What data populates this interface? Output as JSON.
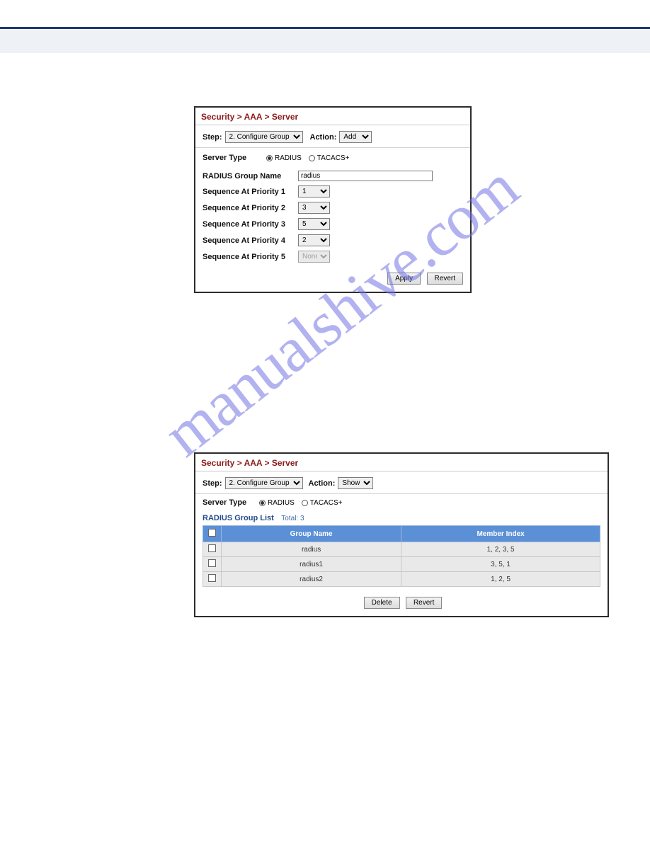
{
  "watermark": "manualshive.com",
  "panel1": {
    "title": "Security > AAA > Server",
    "step_label": "Step:",
    "step_value": "2. Configure Group",
    "action_label": "Action:",
    "action_value": "Add",
    "server_type_label": "Server Type",
    "radio_radius": "RADIUS",
    "radio_tacacs": "TACACS+",
    "group_name_label": "RADIUS Group Name",
    "group_name_value": "radius",
    "seq1_label": "Sequence At Priority 1",
    "seq1_value": "1",
    "seq2_label": "Sequence At Priority 2",
    "seq2_value": "3",
    "seq3_label": "Sequence At Priority 3",
    "seq3_value": "5",
    "seq4_label": "Sequence At Priority 4",
    "seq4_value": "2",
    "seq5_label": "Sequence At Priority 5",
    "seq5_value": "None",
    "apply": "Apply",
    "revert": "Revert"
  },
  "panel2": {
    "title": "Security > AAA > Server",
    "step_label": "Step:",
    "step_value": "2. Configure Group",
    "action_label": "Action:",
    "action_value": "Show",
    "server_type_label": "Server Type",
    "radio_radius": "RADIUS",
    "radio_tacacs": "TACACS+",
    "list_label": "RADIUS Group List",
    "total_label": "Total: 3",
    "col_group": "Group Name",
    "col_member": "Member Index",
    "rows": [
      {
        "name": "radius",
        "members": "1, 2, 3, 5"
      },
      {
        "name": "radius1",
        "members": "3, 5, 1"
      },
      {
        "name": "radius2",
        "members": "1, 2, 5"
      }
    ],
    "delete": "Delete",
    "revert": "Revert"
  }
}
